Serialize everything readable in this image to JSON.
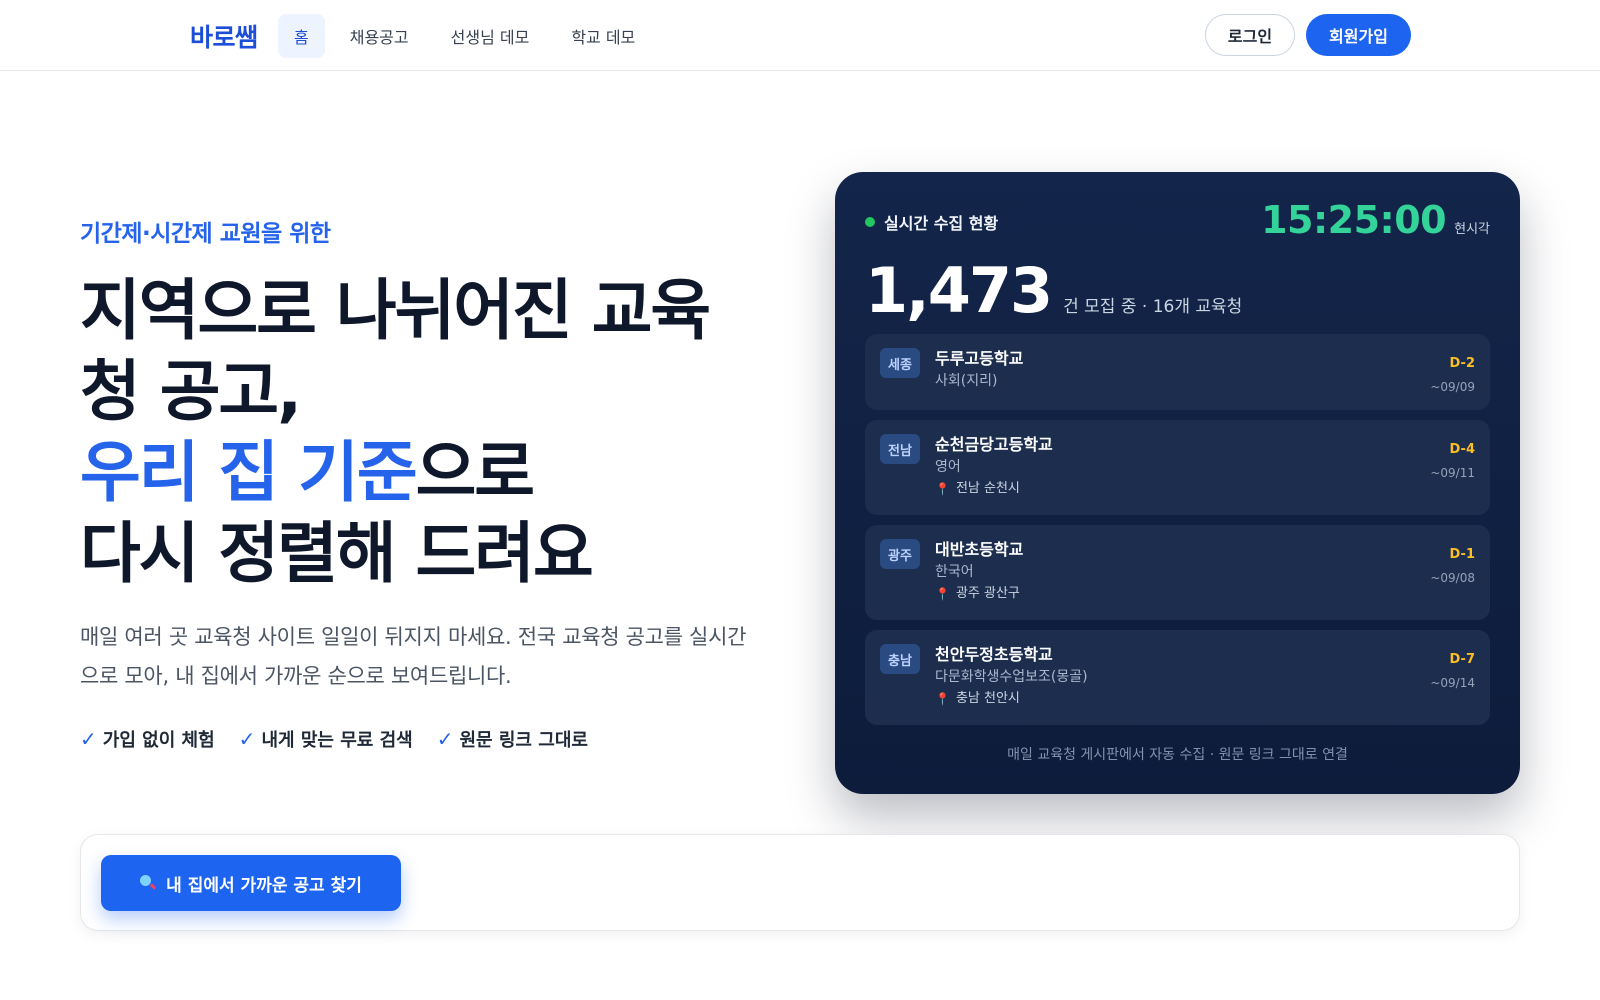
{
  "nav": {
    "brand": "바로쌤",
    "links": [
      "홈",
      "채용공고",
      "선생님 데모",
      "학교 데모"
    ],
    "login": "로그인",
    "signup": "회원가입"
  },
  "hero": {
    "eyebrow": "기간제·시간제 교원을 위한",
    "headline_part1": "지역으로 나뉘어진 교육청 공고,",
    "headline_highlight": "우리 집 기준",
    "headline_part2": "으로",
    "headline_part3": "다시 정렬해 드려요",
    "description": "매일 여러 곳 교육청 사이트 일일이 뒤지지 마세요. 전국 교육청 공고를 실시간으로 모아, 내 집에서 가까운 순으로 보여드립니다.",
    "checks": [
      "가입 없이 체험",
      "내게 맞는 무료 검색",
      "원문 링크 그대로"
    ]
  },
  "live": {
    "title": "실시간 수집 현황",
    "time": "15:25:00",
    "time_label": "현시각",
    "count": "1,473",
    "count_text": "건 모집 중 · 16개 교육청",
    "items": [
      {
        "region": "세종",
        "school": "두루고등학교",
        "subject": "사회(지리)",
        "location": "",
        "dday": "D-2",
        "deadline": "~09/09"
      },
      {
        "region": "전남",
        "school": "순천금당고등학교",
        "subject": "영어",
        "location": "전남 순천시",
        "dday": "D-4",
        "deadline": "~09/11"
      },
      {
        "region": "광주",
        "school": "대반초등학교",
        "subject": "한국어",
        "location": "광주 광산구",
        "dday": "D-1",
        "deadline": "~09/08"
      },
      {
        "region": "충남",
        "school": "천안두정초등학교",
        "subject": "다문화학생수업보조(몽골)",
        "location": "충남 천안시",
        "dday": "D-7",
        "deadline": "~09/14"
      }
    ],
    "footer": "매일 교육청 게시판에서 자동 수집 · 원문 링크 그대로 연결"
  },
  "search": {
    "button": "내 집에서 가까운 공고 찾기"
  },
  "colors": {
    "accent": "#2563eb",
    "card_bg": "#0f1f3f",
    "clock": "#34d399",
    "dday": "#fbbf24"
  }
}
